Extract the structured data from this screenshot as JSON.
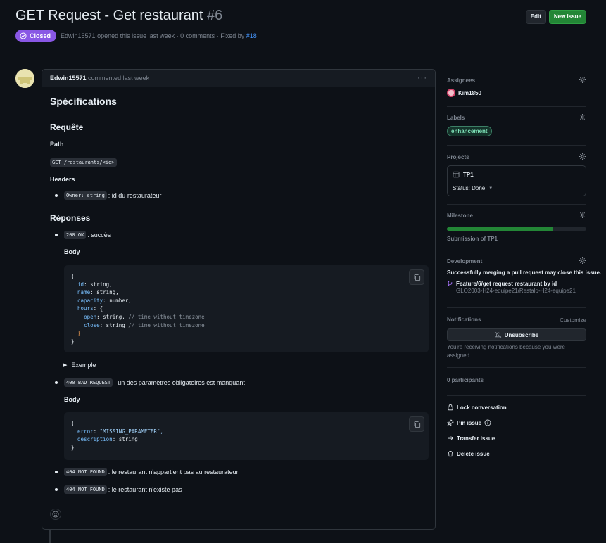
{
  "issue": {
    "title": "GET Request - Get restaurant",
    "number": "#6",
    "state": "Closed",
    "meta": {
      "author": "Edwin15571",
      "opened": "opened this issue last week",
      "comments": "· 0 comments ·",
      "fixed_by_label": "Fixed by",
      "fixed_by": "#18"
    }
  },
  "header_buttons": {
    "edit": "Edit",
    "new_issue": "New issue"
  },
  "comment": {
    "author": "Edwin15571",
    "action": "commented last week",
    "menu": "···",
    "h1": "Spécifications",
    "requete": "Requête",
    "path_label": "Path",
    "path_code": "GET /restaurants/<id>",
    "headers_label": "Headers",
    "headers_item": {
      "code": "Owner: string",
      "text": ": id du restaurateur"
    },
    "reponses": "Réponses",
    "resp_200": {
      "code": "200 OK",
      "text": ": succès"
    },
    "body_label": "Body",
    "details_summary": "Exemple",
    "resp_400": {
      "code": "400 BAD REQUEST",
      "text": ": un des paramètres obligatoires est manquant"
    },
    "resp_404a": {
      "code": "404 NOT FOUND",
      "text": ": le restaurant n'appartient pas au restaurateur"
    },
    "resp_404b": {
      "code": "404 NOT FOUND",
      "text": ": le restaurant n'existe pas"
    },
    "code1": [
      {
        "t": "{",
        "cls": ""
      },
      {
        "k": "id",
        "v": "string,",
        "c": ""
      },
      {
        "k": "name",
        "v": "string,",
        "c": ""
      },
      {
        "k": "capacity",
        "v": "number,",
        "c": ""
      },
      {
        "k": "hours",
        "v": "{",
        "c": ""
      },
      {
        "k": "open",
        "v": "string,",
        "c": "// time without timezone"
      },
      {
        "k": "close",
        "v": "string",
        "c": "// time without timezone"
      }
    ],
    "code2": {
      "error_key": "error",
      "error_val": "\"MISSING_PARAMETER\",",
      "desc_key": "description",
      "desc_val": "string"
    }
  },
  "sidebar": {
    "assignees": {
      "title": "Assignees",
      "user": "Kim1850"
    },
    "labels": {
      "title": "Labels",
      "label": "enhancement"
    },
    "projects": {
      "title": "Projects",
      "name": "TP1",
      "status": "Status: Done"
    },
    "milestone": {
      "title": "Milestone",
      "name": "Submission of TP1",
      "progress": 0.76
    },
    "development": {
      "title": "Development",
      "note": "Successfully merging a pull request may close this issue.",
      "branch": "Feature/6/get request restaurant by id",
      "repo": "GLO2003-H24-equipe21/Restalo-H24-equipe21"
    },
    "notifications": {
      "title": "Notifications",
      "customize": "Customize",
      "unsubscribe": "Unsubscribe",
      "note": "You're receiving notifications because you were assigned."
    },
    "participants": "0 participants",
    "actions": {
      "lock": "Lock conversation",
      "pin": "Pin issue",
      "transfer": "Transfer issue",
      "delete": "Delete issue"
    }
  },
  "colors": {
    "closed_badge": "#8957e5",
    "new_issue": "#238636",
    "link": "#4493f8",
    "label": "#7ee2b8"
  }
}
